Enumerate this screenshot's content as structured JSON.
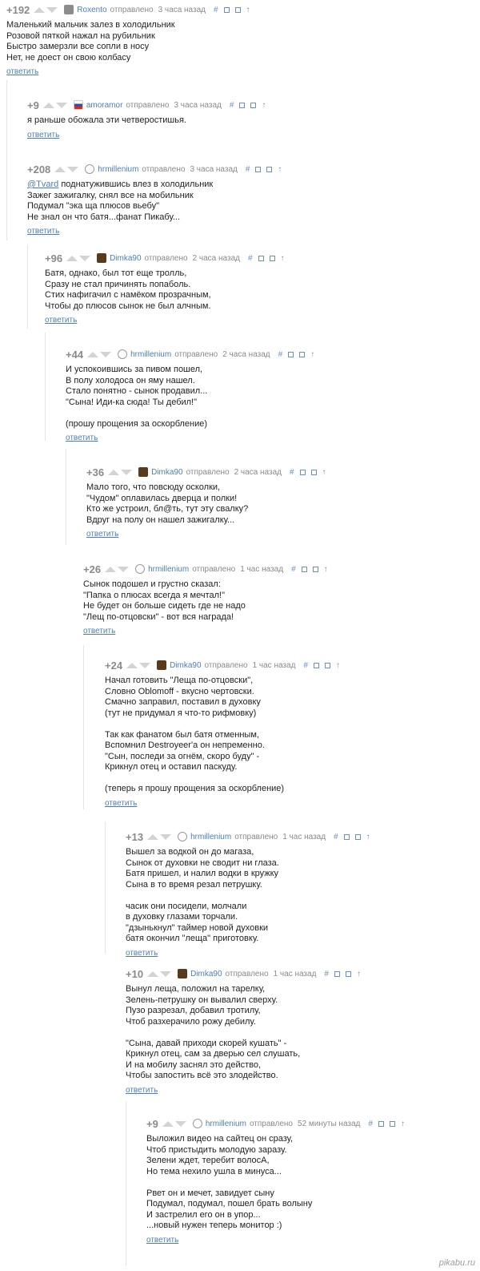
{
  "ui": {
    "sent_label": "отправлено",
    "reply_label": "ответить",
    "icons": {
      "anchor": "#",
      "minus": "⊟",
      "save": "💾",
      "parent": "↑"
    }
  },
  "watermark": "pikabu.ru",
  "comments": [
    {
      "rating": "+192",
      "nick": "Roxento",
      "time": "3 часа назад",
      "avatar": "gray",
      "lines": [
        "Маленький мальчик залез в холодильник",
        "Розовой пяткой нажал на рубильник",
        "Быстро замерзли все сопли в носу",
        "Нет, не доест он свою колбасу"
      ]
    },
    {
      "rating": "+9",
      "nick": "amoramor",
      "time": "3 часа назад",
      "avatar": "flag",
      "lines": [
        "я раньше обожала эти четверостишья."
      ]
    },
    {
      "rating": "+208",
      "nick": "hrmillenium",
      "time": "3 часа назад",
      "avatar": "face",
      "mention": "@Tvard",
      "lines": [
        " поднатужившись влез в холодильник",
        "Зажег зажигалку, снял все на мобильник",
        "Подумал \"эка ща плюсов вьебу\"",
        "Не знал он что батя...фанат Пикабу..."
      ]
    },
    {
      "rating": "+96",
      "nick": "Dimka90",
      "time": "2 часа назад",
      "avatar": "dark",
      "lines": [
        "Батя, однако, был тот еще тролль,",
        "Сразу не стал причинять попаболь.",
        "Стих нафигачил с намёком прозрачным,",
        "Чтобы до плюсов сынок не был алчным."
      ]
    },
    {
      "rating": "+44",
      "nick": "hrmillenium",
      "time": "2 часа назад",
      "avatar": "face",
      "lines": [
        "И успокоившись за пивом пошел,",
        "В полу холодоса он яму нашел.",
        "Стало понятно - сынок продавил...",
        "\"Сына! Иди-ка сюда! Ты дебил!\"",
        "",
        "(прошу прощения за оскорбление)"
      ]
    },
    {
      "rating": "+36",
      "nick": "Dimka90",
      "time": "2 часа назад",
      "avatar": "dark",
      "lines": [
        "Мало того, что повсюду осколки,",
        "\"Чудом\" оплавилась дверца и полки!",
        "Кто же устроил, бл@ть, тут эту свалку?",
        "Вдруг на полу он нашел зажигалку..."
      ]
    },
    {
      "rating": "+26",
      "nick": "hrmillenium",
      "time": "1 час назад",
      "avatar": "face",
      "lines": [
        "Сынок подошел и грустно сказал:",
        "\"Папка о плюсах всегда я мечтал!\"",
        "Не будет он больше сидеть где не надо",
        "\"Лещ по-отцовски\" - вот вся награда!"
      ]
    },
    {
      "rating": "+24",
      "nick": "Dimka90",
      "time": "1 час назад",
      "avatar": "dark",
      "lines": [
        "Начал готовить \"Леща по-отцовски\",",
        "Словно Oblomoff - вкусно чертовски.",
        "Смачно заправил, поставил в духовку",
        "(тут не придумал я что-то рифмовку)",
        "",
        "Так как фанатом был батя отменным,",
        "Вспомнил Destroyeer'a он непременно.",
        "\"Сын, последи за огнём, скоро буду\" -",
        "Крикнул отец и оставил паскуду.",
        "",
        "(теперь я прошу прощения за оскорбление)"
      ]
    },
    {
      "rating": "+13",
      "nick": "hrmillenium",
      "time": "1 час назад",
      "avatar": "face",
      "lines": [
        "Вышел за водкой он до магаза,",
        "Сынок от духовки не сводит ни глаза.",
        "Батя пришел, и налил водки в кружку",
        "Сына в то время резал петрушку.",
        "",
        "часик они посидели, молчали",
        "в духовку глазами торчали.",
        "\"дзынькнул\" таймер новой духовки",
        "батя окончил \"леща\" приготовку."
      ]
    },
    {
      "rating": "+10",
      "nick": "Dimka90",
      "time": "1 час назад",
      "avatar": "dark",
      "lines": [
        "Вынул леща, положил на тарелку,",
        "Зелень-петрушку он вывалил сверху.",
        "Пузо разрезал, добавил тротилу,",
        "Чтоб разхерачило рожу дебилу.",
        "",
        "\"Сына, давай приходи скорей кушать\" -",
        "Крикнул отец, сам за дверью сел слушать,",
        "И на мобилу заснял это действо,",
        "Чтобы запостить всё это злодейство."
      ]
    },
    {
      "rating": "+9",
      "nick": "hrmillenium",
      "time": "52 минуты назад",
      "avatar": "face",
      "lines": [
        "Выложил видео на сайтец он сразу,",
        "Чтоб пристыдить молодую заразу.",
        "Зелени ждет, теребит волосА,",
        "Но тема нехило ушла в минуса...",
        "",
        "Рвет он и мечет, завидует сыну",
        "Подумал, подумал, пошел брать волыну",
        "И застрелил его он в упор...",
        "...новый нужен теперь монитор :)"
      ]
    }
  ]
}
